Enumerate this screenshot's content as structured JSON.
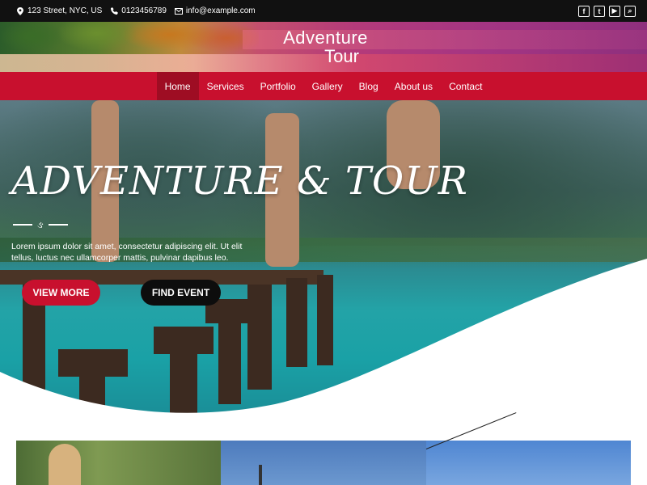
{
  "topbar": {
    "address": "123 Street, NYC, US",
    "phone": "0123456789",
    "email": "info@example.com",
    "social": [
      {
        "icon": "facebook-icon",
        "glyph": "f"
      },
      {
        "icon": "twitter-icon",
        "glyph": "t"
      },
      {
        "icon": "youtube-icon",
        "glyph": "▶"
      },
      {
        "icon": "search-icon",
        "glyph": "⌕"
      }
    ]
  },
  "header": {
    "logo_line1": "Adventure",
    "logo_line2": "Tour"
  },
  "nav": {
    "items": [
      "Home",
      "Services",
      "Portfolio",
      "Gallery",
      "Blog",
      "About us",
      "Contact"
    ],
    "active": "Home"
  },
  "hero": {
    "title": "ADVENTURE & TOUR",
    "divider_mark": "ઙ",
    "text": "Lorem ipsum dolor sit amet, consectetur adipiscing elit. Ut elit tellus, luctus nec ullamcorper mattis, pulvinar dapibus leo.",
    "btn_view": "VIEW MORE",
    "btn_find": "FIND EVENT"
  },
  "colors": {
    "accent": "#c8102e",
    "topbar": "#111111",
    "button_dark": "#0d0d0d"
  }
}
